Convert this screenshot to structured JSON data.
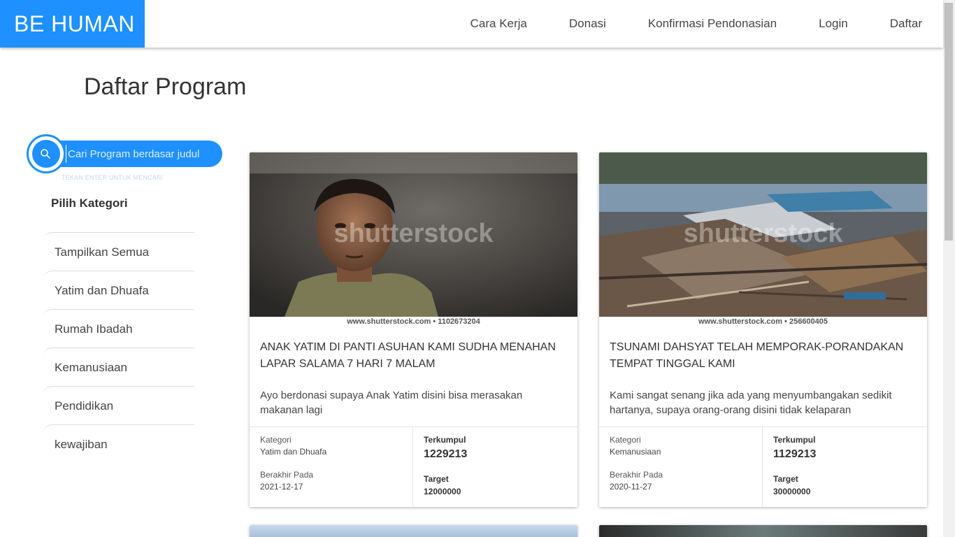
{
  "header": {
    "brand": "BE HUMAN",
    "nav": [
      "Cara Kerja",
      "Donasi",
      "Konfirmasi Pendonasian",
      "Login",
      "Daftar"
    ]
  },
  "page": {
    "title": "Daftar Program"
  },
  "search": {
    "placeholder": "Cari Program berdasar judul",
    "hint": "TEKAN ENTER UNTUK MENCARI"
  },
  "categories": {
    "title": "Pilih Kategori",
    "items": [
      "Tampilkan Semua",
      "Yatim dan Dhuafa",
      "Rumah Ibadah",
      "Kemanusiaan",
      "Pendidikan",
      "kewajiban"
    ]
  },
  "labels": {
    "kategori": "Kategori",
    "berakhir": "Berakhir Pada",
    "terkumpul": "Terkumpul",
    "target": "Target"
  },
  "programs": [
    {
      "image_caption": "www.shutterstock.com • 1102673204",
      "watermark": "shutterstock",
      "title": "ANAK YATIM DI PANTI ASUHAN KAMI SUDHA MENAHAN LAPAR SALAMA 7 HARI 7 MALAM",
      "description": "Ayo berdonasi supaya Anak Yatim disini bisa merasakan makanan lagi",
      "category": "Yatim dan Dhuafa",
      "end_date": "2021-12-17",
      "collected": "1229213",
      "target": "12000000"
    },
    {
      "image_caption": "www.shutterstock.com • 256600405",
      "watermark": "shutterstock",
      "title": "TSUNAMI DAHSYAT TELAH MEMPORAK-PORANDAKAN TEMPAT TINGGAL KAMI",
      "description": "Kami sangat senang jika ada yang menyumbangakan sedikit hartanya, supaya orang-orang disini tidak kelaparan",
      "category": "Kemanusiaan",
      "end_date": "2020-11-27",
      "collected": "1129213",
      "target": "30000000"
    }
  ],
  "colors": {
    "brand": "#1e90ff"
  }
}
